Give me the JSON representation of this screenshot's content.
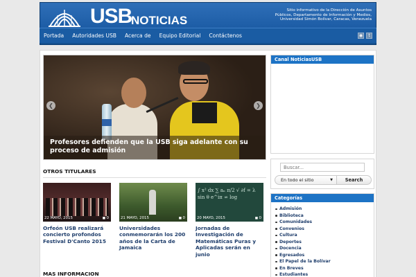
{
  "header": {
    "logo_usb": "USB",
    "logo_noticias": "NOTICIAS",
    "tagline": "Sitio informativo de la Dirección de Asuntos Públicos, Departamento de Información y Medios, Universidad Simón Bolívar, Caracas, Venezuela"
  },
  "nav": {
    "items": [
      "Portada",
      "Autoridades USB",
      "Acerca de",
      "Equipo Editorial",
      "Contáctenos"
    ],
    "icons": [
      "rss-icon",
      "twitter-icon"
    ]
  },
  "slider": {
    "title": "Profesores defienden que la USB siga adelante con su proceso de admisión"
  },
  "otros": {
    "heading": "OTROS TITULARES",
    "items": [
      {
        "date": "22 MAYO, 2015",
        "count": "0",
        "title": "Orfeón USB realizará concierto profondos Festival D'Canto 2015"
      },
      {
        "date": "21 MAYO, 2015",
        "count": "0",
        "title": "Universidades conmemorarán los 200 años de la Carta de Jamaica"
      },
      {
        "date": "20 MAYO, 2015",
        "count": "0",
        "title": "Jornadas de Investigación de Matemáticas Puras y Aplicadas serán en junio"
      }
    ]
  },
  "mas": {
    "heading": "MAS INFORMACION"
  },
  "sidebar": {
    "canal_title": "Canal NoticiasUSB",
    "search_placeholder": "Buscar...",
    "scope_label": "En todo el sitio",
    "search_button": "Search",
    "categories_title": "Categorías",
    "categories": [
      "Admisión",
      "Biblioteca",
      "Comunidades",
      "Convenios",
      "Cultura",
      "Deportes",
      "Docencia",
      "Egresados",
      "El Papel de la Bolívar",
      "En Breves",
      "Estudiantes"
    ]
  }
}
